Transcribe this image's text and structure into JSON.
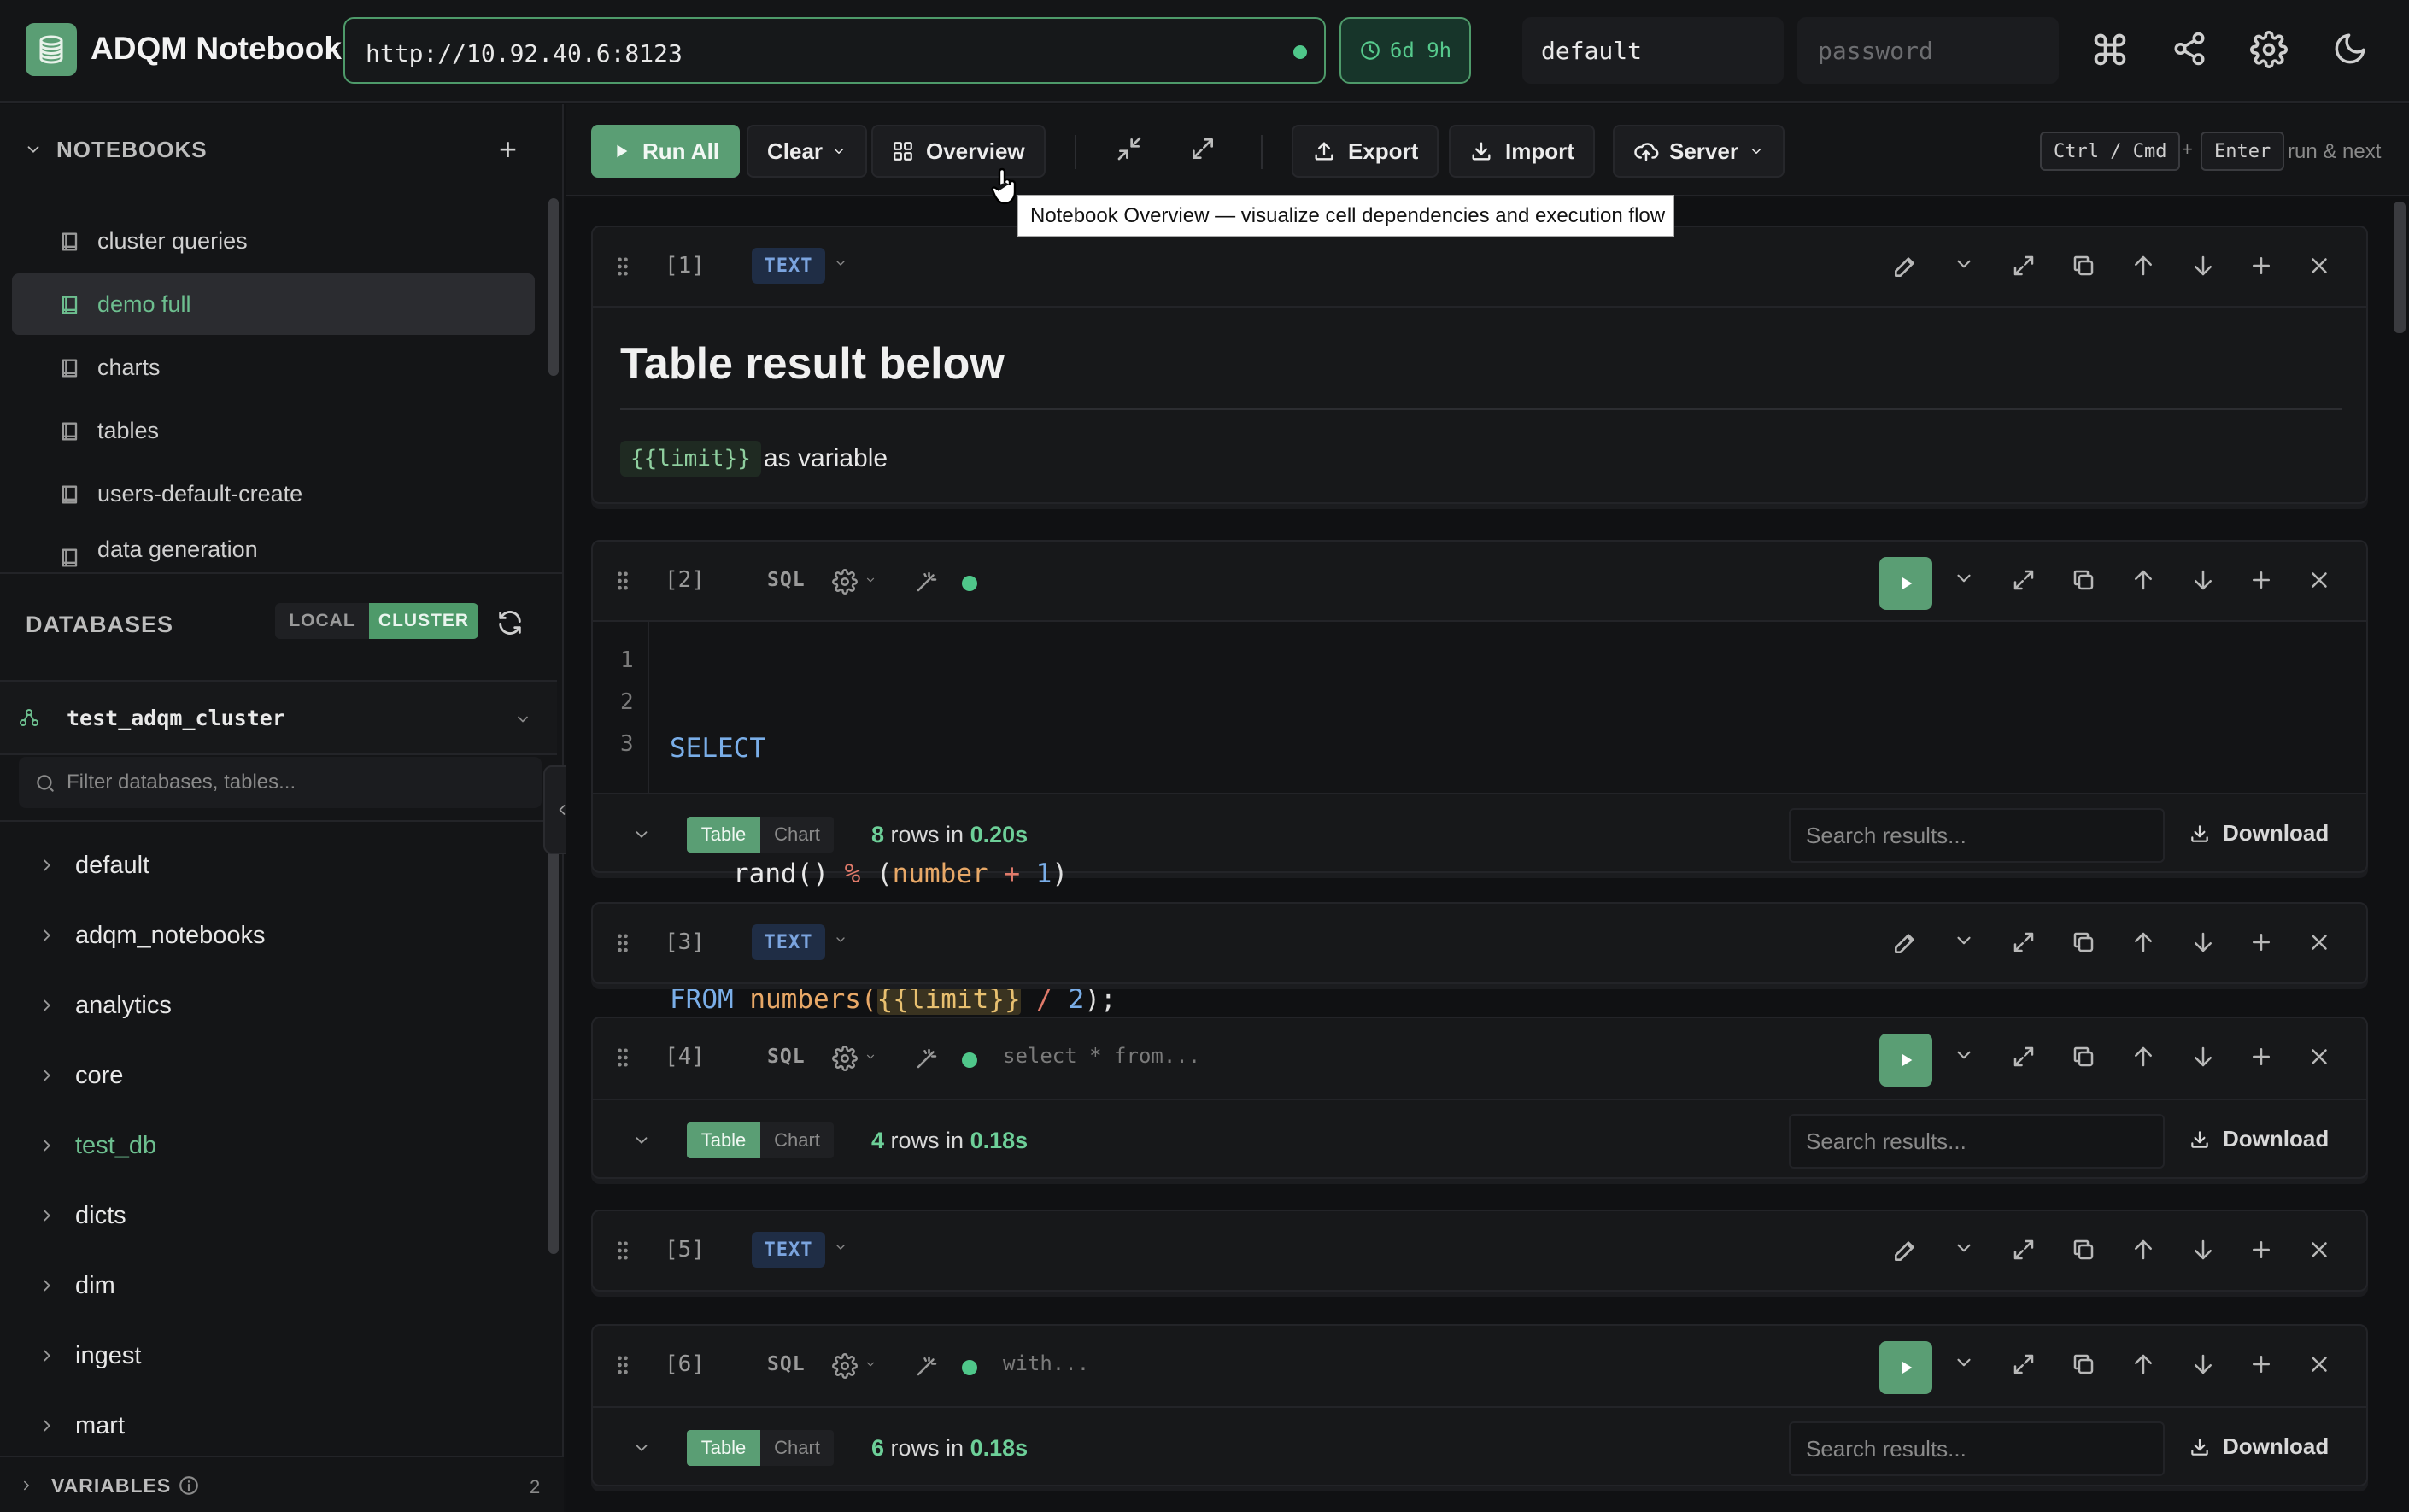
{
  "header": {
    "app_title": "ADQM Notebook",
    "url": "http://10.92.40.6:8123",
    "uptime": "6d 9h",
    "user": "default",
    "password_placeholder": "password"
  },
  "toolbar": {
    "run_all": "Run All",
    "clear": "Clear",
    "overview": "Overview",
    "export": "Export",
    "import": "Import",
    "server": "Server",
    "kbd_mod": "Ctrl / Cmd",
    "kbd_plus": "+",
    "kbd_enter": "Enter",
    "kbd_hint": "run & next",
    "tooltip": "Notebook Overview — visualize cell dependencies and execution flow"
  },
  "sidebar": {
    "notebooks_title": "NOTEBOOKS",
    "add": "+",
    "notebooks": [
      "cluster queries",
      "demo full",
      "charts",
      "tables",
      "users-default-create",
      "data generation"
    ],
    "databases_title": "DATABASES",
    "local": "LOCAL",
    "cluster": "CLUSTER",
    "cluster_name": "test_adqm_cluster",
    "filter_placeholder": "Filter databases, tables...",
    "databases": [
      "default",
      "adqm_notebooks",
      "analytics",
      "core",
      "test_db",
      "dicts",
      "dim",
      "ingest",
      "mart"
    ],
    "variables_title": "VARIABLES",
    "variables_count": "2"
  },
  "cells": {
    "c1": {
      "num": "[1]",
      "type": "TEXT",
      "heading": "Table result below",
      "var_chip": "{{limit}}",
      "var_text": "as variable"
    },
    "c2": {
      "num": "[2]",
      "type": "SQL",
      "lines": [
        "1",
        "2",
        "3"
      ],
      "code_select": "SELECT",
      "code_fn": "rand()",
      "code_op": "%",
      "code_paren1": "(",
      "code_ident": "number",
      "code_plus": "+",
      "code_one": "1",
      "code_paren2": ")",
      "code_from": "FROM",
      "code_numbers": "numbers(",
      "code_var": "{{limit}}",
      "code_div": "/",
      "code_two": "2",
      "code_end": ");",
      "table": "Table",
      "chart": "Chart",
      "rows": "8",
      "rows_in": "rows in",
      "time": "0.20s",
      "search_placeholder": "Search results...",
      "download": "Download"
    },
    "c3": {
      "num": "[3]",
      "type": "TEXT"
    },
    "c4": {
      "num": "[4]",
      "type": "SQL",
      "preview": "select * from...",
      "table": "Table",
      "chart": "Chart",
      "rows": "4",
      "rows_in": "rows in",
      "time": "0.18s",
      "search_placeholder": "Search results...",
      "download": "Download"
    },
    "c5": {
      "num": "[5]",
      "type": "TEXT"
    },
    "c6": {
      "num": "[6]",
      "type": "SQL",
      "preview": "with...",
      "table": "Table",
      "chart": "Chart",
      "rows": "6",
      "rows_in": "rows in",
      "time": "0.18s",
      "search_placeholder": "Search results...",
      "download": "Download"
    }
  },
  "colors": {
    "accent": "#5a9e74",
    "accent_text": "#6dbf8f",
    "status": "#4fc78a",
    "text_tag": "#7ba4de",
    "bg": "#111214"
  }
}
